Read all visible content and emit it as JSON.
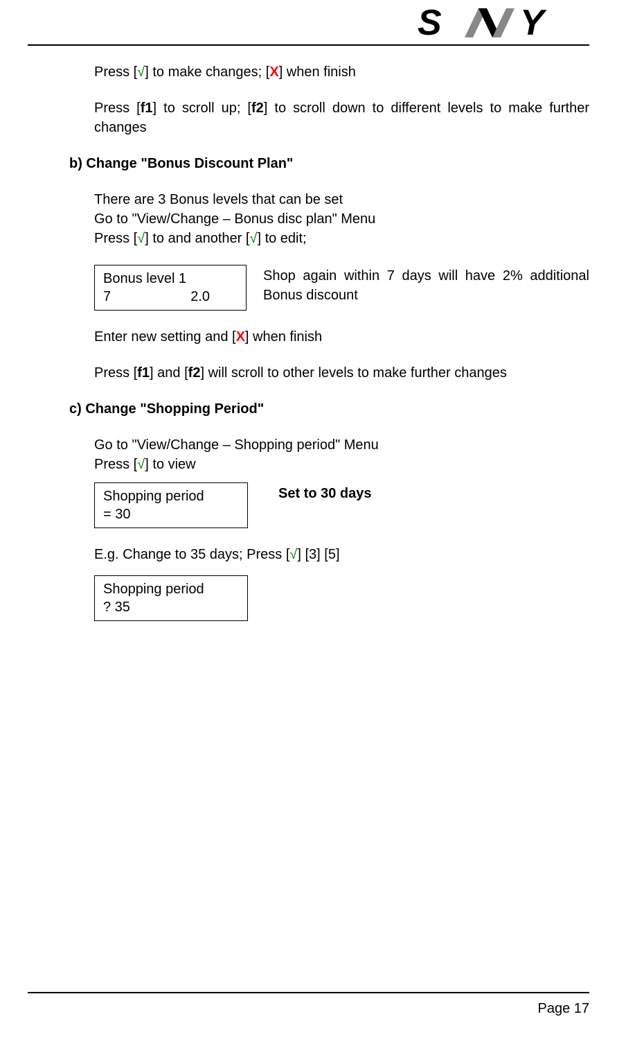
{
  "header": {
    "logo_text": "SVY"
  },
  "intro": {
    "line1_a": "Press [",
    "line1_b": "]  to make changes; [",
    "line1_c": "] when finish",
    "check": "√",
    "x": "X",
    "line2_a": "Press   [",
    "line2_f1": "f1",
    "line2_b": "]  to scroll up;  [",
    "line2_f2": "f2",
    "line2_c": "]  to scroll down to different levels to make further changes"
  },
  "section_b": {
    "heading": "b) Change \"Bonus Discount Plan\"",
    "line1": "There are 3 Bonus levels that can be set",
    "line2": "Go to \"View/Change – Bonus disc plan\" Menu",
    "line3_a": "Press [",
    "line3_b": "] to and another [",
    "line3_c": "] to edit;",
    "check": "√",
    "display_line1": "Bonus  level  1",
    "display_line2_left": "7",
    "display_line2_right": "2.0",
    "display_desc": "Shop  again  within  7  days  will  have  2% additional Bonus discount",
    "line4_a": "Enter new setting and [",
    "line4_x": "X",
    "line4_b": "] when finish",
    "line5_a": "Press   [",
    "line5_f1": "f1",
    "line5_b": "] and  [",
    "line5_f2": "f2",
    "line5_c": "] will scroll to other levels to make further changes"
  },
  "section_c": {
    "heading": "c) Change \"Shopping Period\"",
    "line1": "Go to \"View/Change – Shopping period\" Menu",
    "line2_a": "Press [",
    "line2_check": "√",
    "line2_b": "] to view",
    "display1_line1": "Shopping period",
    "display1_line2": "= 30",
    "display1_desc": "Set to 30 days",
    "line3_a": "E.g. Change to 35 days; Press [",
    "line3_check": "√",
    "line3_b": "] [3] [5]",
    "display2_line1": "Shopping period",
    "display2_line2": "? 35"
  },
  "footer": {
    "page": "Page 17"
  }
}
